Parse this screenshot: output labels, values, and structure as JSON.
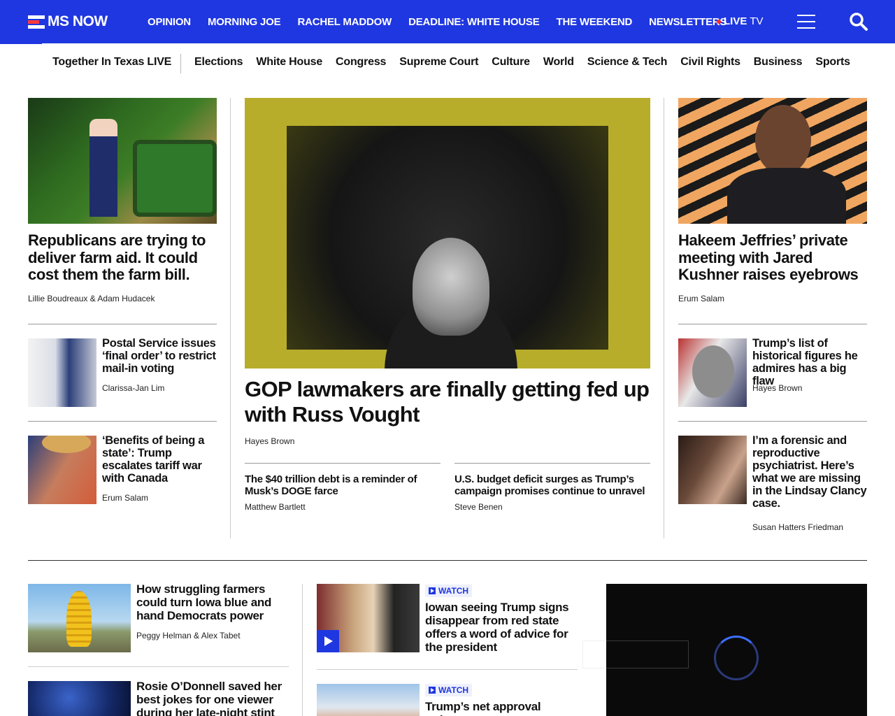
{
  "brand": {
    "name": "MS NOW",
    "accent": "#1f37e0",
    "live_dot": "#ff2b2b"
  },
  "topnav": {
    "items": [
      "OPINION",
      "MORNING JOE",
      "RACHEL MADDOW",
      "DEADLINE: WHITE HOUSE",
      "THE WEEKEND",
      "NEWSLETTERS"
    ],
    "live_label": "LIVE",
    "live_tv": "TV",
    "menu_icon": "hamburger-icon",
    "search_icon": "search-icon"
  },
  "subnav": {
    "featured": "Together In Texas LIVE",
    "items": [
      "Elections",
      "White House",
      "Congress",
      "Supreme Court",
      "Culture",
      "World",
      "Science & Tech",
      "Civil Rights",
      "Business",
      "Sports"
    ]
  },
  "left": {
    "lead": {
      "headline": "Republicans are trying to deliver farm aid. It could cost them the farm bill.",
      "byline": "Lillie Boudreaux & Adam Hudacek"
    },
    "items": [
      {
        "headline": "Postal Service issues ‘final order’ to restrict mail-in voting",
        "byline": "Clarissa-Jan Lim"
      },
      {
        "headline": "‘Benefits of being a state’: Trump escalates tariff war with Canada",
        "byline": "Erum Salam"
      }
    ]
  },
  "center": {
    "lead": {
      "headline": "GOP lawmakers are finally getting fed up with Russ Vought",
      "byline": "Hayes Brown"
    },
    "related": [
      {
        "headline": "The $40 trillion debt is a reminder of Musk’s DOGE farce",
        "byline": "Matthew Bartlett"
      },
      {
        "headline": "U.S. budget deficit surges as Trump’s campaign promises continue to unravel",
        "byline": "Steve Benen"
      }
    ]
  },
  "right": {
    "lead": {
      "headline": "Hakeem Jeffries’ private meeting with Jared Kushner raises eyebrows",
      "byline": "Erum Salam"
    },
    "items": [
      {
        "headline": "Trump’s list of historical figures he admires has a big flaw",
        "byline": "Hayes Brown"
      },
      {
        "headline": "I’m a forensic and reproductive psychiatrist. Here’s what we are missing in the Lindsay Clancy case.",
        "byline": "Susan Hatters Friedman"
      }
    ]
  },
  "bottom": {
    "col1": [
      {
        "headline": "How struggling farmers could turn Iowa blue and hand Democrats power",
        "byline": "Peggy Helman & Alex Tabet"
      },
      {
        "headline": "Rosie O’Donnell saved her best jokes for one viewer during her late-night stint"
      }
    ],
    "col2": [
      {
        "badge": "WATCH",
        "headline": "Iowan seeing Trump signs disappear from red state offers a word of advice for the president"
      },
      {
        "badge": "WATCH",
        "headline": "Trump’s net approval rating"
      }
    ]
  }
}
